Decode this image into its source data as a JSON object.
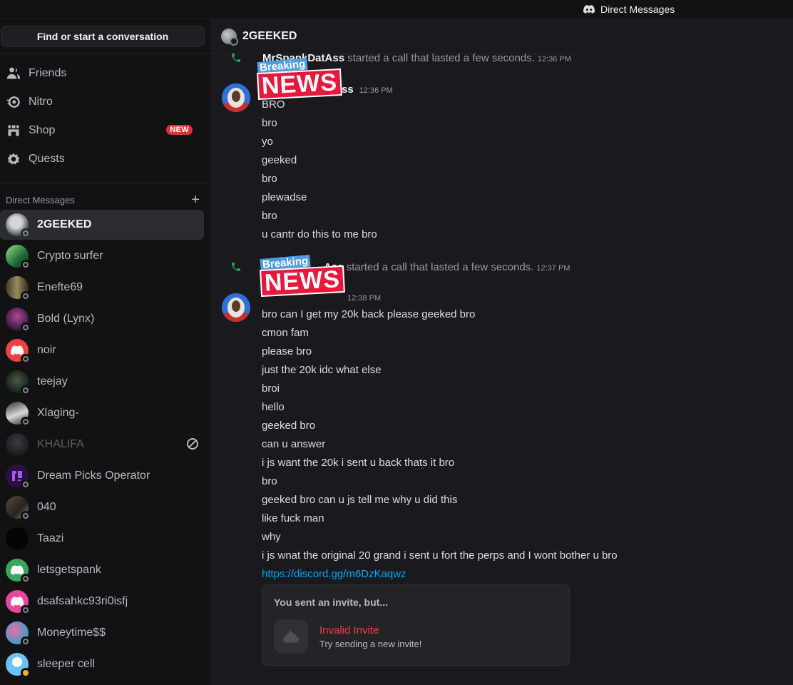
{
  "window": {
    "title": "Direct Messages"
  },
  "sidebar": {
    "search_label": "Find or start a conversation",
    "nav": [
      {
        "label": "Friends",
        "icon": "friends-icon"
      },
      {
        "label": "Nitro",
        "icon": "nitro-icon"
      },
      {
        "label": "Shop",
        "icon": "shop-icon",
        "badge": "NEW"
      },
      {
        "label": "Quests",
        "icon": "quests-icon"
      }
    ],
    "dm_header": "Direct Messages",
    "dm_add_symbol": "+",
    "dms": [
      {
        "name": "2GEEKED"
      },
      {
        "name": "Crypto surfer"
      },
      {
        "name": "Enefte69"
      },
      {
        "name": "Bold (Lynx)"
      },
      {
        "name": "noir"
      },
      {
        "name": "teejay"
      },
      {
        "name": "Xlaging-"
      },
      {
        "name": "KHALIFA"
      },
      {
        "name": "Dream Picks Operator"
      },
      {
        "name": "040"
      },
      {
        "name": "Taazi"
      },
      {
        "name": "letsgetspank"
      },
      {
        "name": "dsafsahkc93ri0isfj"
      },
      {
        "name": "Moneytime$$"
      },
      {
        "name": "sleeper cell"
      }
    ]
  },
  "chat": {
    "header_name": "2GEEKED",
    "call1": {
      "user": "MrSpankDatAss",
      "text": "started a call that lasted a few seconds.",
      "time": "12:36 PM"
    },
    "group1": {
      "author_tail": "ss",
      "time": "12:36 PM",
      "lines": [
        "BRO",
        "bro",
        "yo",
        "geeked",
        "bro",
        "plewadse",
        "bro",
        "u cantr do this to me bro"
      ]
    },
    "call2": {
      "user": "Ass",
      "text": "started a call that lasted a few seconds.",
      "time": "12:37 PM"
    },
    "group2": {
      "time": "12:38 PM",
      "lines": [
        "bro can I get my 20k back please geeked bro",
        "cmon fam",
        "please bro",
        "just the 20k idc what else",
        "broi",
        "hello",
        "geeked bro",
        "can u answer",
        "i js want the 20k i sent u back thats it bro",
        "bro",
        "geeked bro can u js tell me why u did this",
        "like fuck man",
        "why",
        "i js wnat the original 20 grand i sent u fort the perps and I wont bother u bro"
      ],
      "link": "https://discord.gg/m6DzKaqwz"
    },
    "invite": {
      "heading": "You sent an invite, but...",
      "title": "Invalid Invite",
      "subtitle": "Try sending a new invite!"
    },
    "overlay": {
      "breaking": "Breaking",
      "news": "NEWS"
    }
  }
}
